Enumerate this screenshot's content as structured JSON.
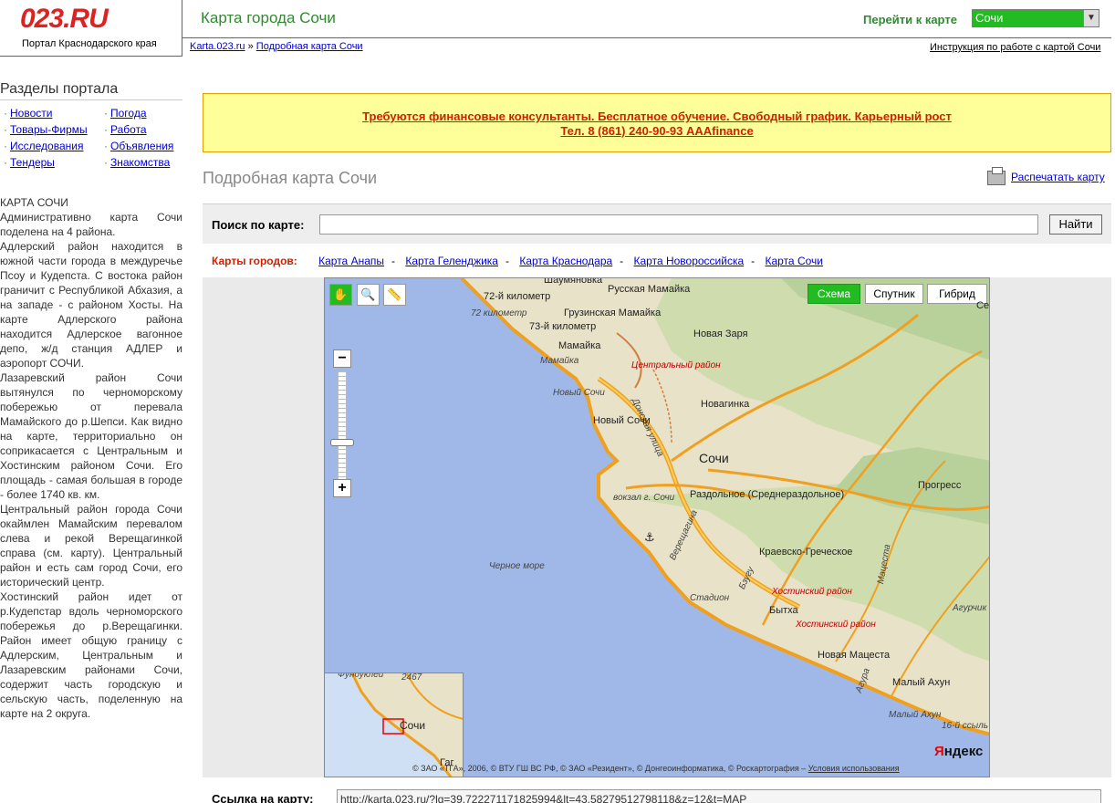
{
  "header": {
    "logo_text": "023",
    "logo_suffix": ".RU",
    "logo_sub": "Портал Краснодарского края",
    "page_title": "Карта города Сочи",
    "goto_label": "Перейти к карте",
    "goto_value": "Сочи",
    "crumb_1": "Karta.023.ru",
    "crumb_sep": "»",
    "crumb_2": "Подробная карта Сочи",
    "help_link": "Инструкция по работе с картой Сочи"
  },
  "sidebar": {
    "title": "Разделы портала",
    "bullet": "·",
    "items": [
      {
        "label": "Новости"
      },
      {
        "label": "Погода"
      },
      {
        "label": "Товары-Фирмы"
      },
      {
        "label": "Работа"
      },
      {
        "label": "Исследования"
      },
      {
        "label": "Объявления"
      },
      {
        "label": "Тендеры"
      },
      {
        "label": "Знакомства"
      }
    ],
    "about_heading": "КАРТА СОЧИ",
    "about_paragraphs": [
      "Административно карта Сочи поделена на 4 района.",
      "Адлерский район находится в южной части города в междуречье Псоу и Кудепста. С востока район граничит с Республикой Абхазия, а на западе - с районом Хосты. На карте Адлерского района находится Адлерское вагонное депо, ж/д станция АДЛЕР и аэропорт СОЧИ.",
      "Лазаревский район Сочи вытянулся по черноморскому побережью от перевала Мамайского до р.Шепси. Как видно на карте, территориально он соприкасается с Центральным и Хостинским районом Сочи. Его площадь - самая большая в городе - более 1740 кв. км.",
      "Центральный район города Сочи окаймлен Мамайским перевалом слева и рекой Верещагинкой справа (см. карту). Центральный район и есть сам город Сочи, его исторический центр.",
      "Хостинский район идет от р.Кудепстар вдоль черноморского побережья до р.Верещагинки. Район имеет общую границу с Адлерским, Центральным и Лазаревским районами Сочи, содержит часть городскую и сельскую часть, поделенную на карте на 2 округа."
    ]
  },
  "banner": {
    "line1": "Требуются финансовые консультанты. Бесплатное обучение. Свободный график. Карьерный рост",
    "line2": "Тел. 8 (861) 240-90-93 AAAfinance"
  },
  "main": {
    "map_title": "Подробная карта Сочи",
    "print_label": "Распечатать карту",
    "search_label": "Поиск по карте:",
    "search_value": "",
    "search_button": "Найти",
    "cities_label": "Карты городов:",
    "cities": [
      {
        "label": "Карта Анапы"
      },
      {
        "label": "Карта Геленджика"
      },
      {
        "label": "Карта Краснодара"
      },
      {
        "label": "Карта Новороссийска"
      },
      {
        "label": "Карта Сочи"
      }
    ],
    "city_sep": "-",
    "link_label": "Ссылка на карту:",
    "link_value": "http://karta.023.ru/?lg=39.722271171825994&lt=43.58279512798118&z=12&t=MAP"
  },
  "map": {
    "types": [
      {
        "label": "Схема",
        "active": true
      },
      {
        "label": "Спутник",
        "active": false
      },
      {
        "label": "Гибрид",
        "active": false
      }
    ],
    "labels": {
      "shaumyanovka": "Шаумяновка",
      "km72": "72-й километр",
      "km72i": "72 километр",
      "russkaya_mamayka": "Русская Мамайка",
      "gruzinka": "Грузинская Мамайка",
      "km73": "73-й километр",
      "mamayka": "Мамайка",
      "mamayka_i": "Мамайка",
      "novaya_zarya": "Новая Заря",
      "central_district": "Центральный район",
      "novy_sochi_i": "Новый Сочи",
      "donskaya": "Донская улица",
      "novagunka": "Новагинка",
      "novy_sochi": "Новый Сочи",
      "sochi": "Сочи",
      "razdolnoe": "Раздольное (Среднераздольное)",
      "vokzal": "вокзал г. Сочи",
      "progress": "Прогресс",
      "krasnogr": "Краевско-Греческое",
      "chernoe_more": "Черное море",
      "khostinsky1": "Хостинский район",
      "stadion": "Стадион",
      "bytkha": "Бытха",
      "khostinsky2": "Хостинский район",
      "agurchik": "Агурчик",
      "novaya_matsesta": "Новая Мацеста",
      "maly_akhun": "Малый Ахун",
      "maly_akhun_i": "Малый Ахун",
      "km16": "16-й ссыль",
      "se": "Се",
      "verescha": "Верещагина",
      "bzugu": "Бзугу",
      "matsesta_r": "Мацеста",
      "agura": "Агура",
      "mini_sochi": "Сочи",
      "mini_top": "Фундуклей",
      "mini_num": "2467",
      "mini_bottom": "Гаг"
    },
    "copyright": "© ЗАО «ТГА», 2006, © ВТУ ГШ ВС РФ, © ЗАО «Резидент», © Донгеоинформатика, © Роскартография –",
    "terms_link": "Условия использования",
    "brand": "Яндекс",
    "brand_first": "Я",
    "brand_rest": "ндекс"
  }
}
